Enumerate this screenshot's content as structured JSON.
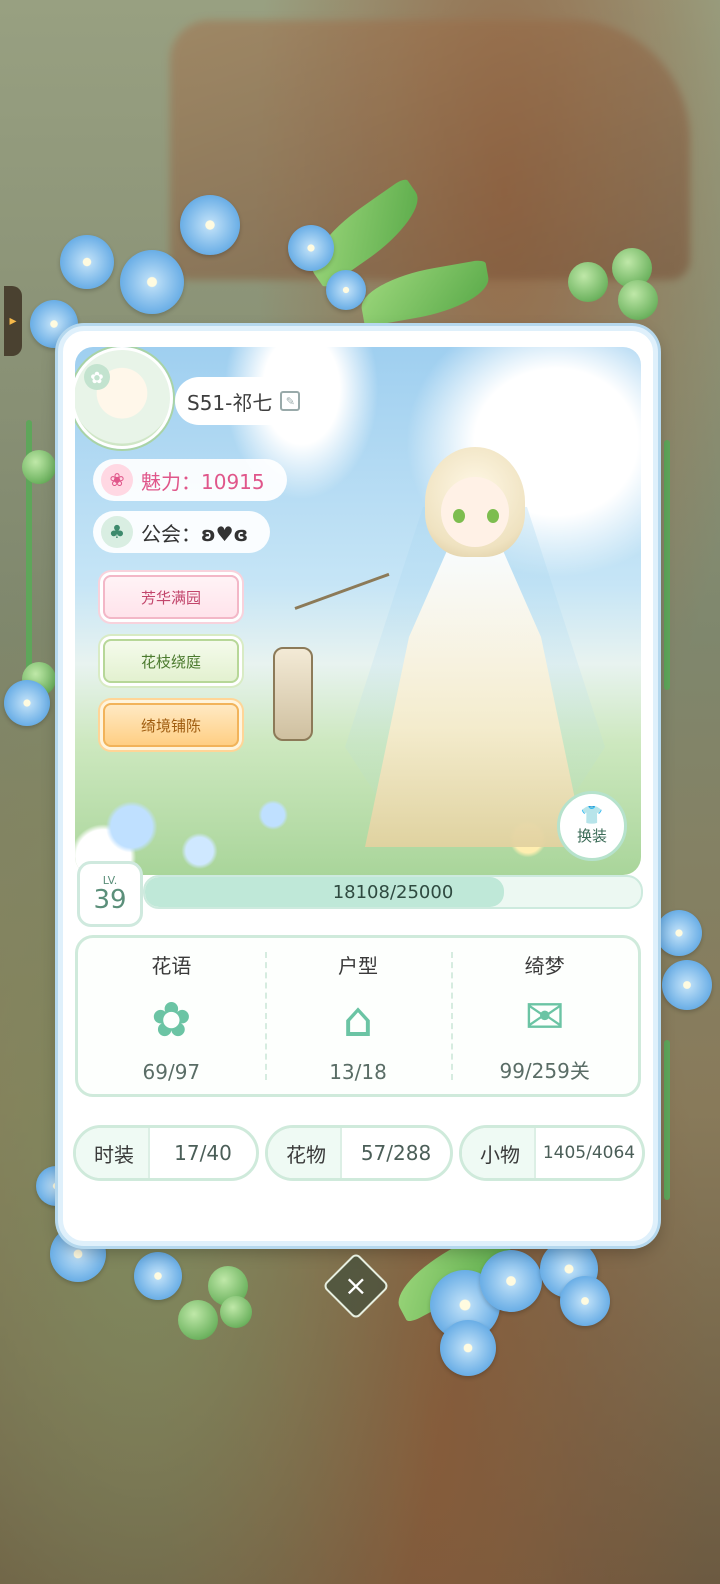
{
  "profile": {
    "name": "S51-祁七",
    "charm_label": "魅力：",
    "charm_value": "10915",
    "guild_label": "公会：",
    "guild_value": "ʚ♥ɞ"
  },
  "titles": [
    "芳华满园",
    "花枝绕庭",
    "绮境铺陈"
  ],
  "outfit_button": "换装",
  "level": {
    "lv_label": "LV.",
    "value": "39",
    "xp_text": "18108/25000",
    "xp_current": 18108,
    "xp_max": 25000
  },
  "collections": [
    {
      "title": "花语",
      "count": "69/97",
      "icon": "flower-icon"
    },
    {
      "title": "户型",
      "count": "13/18",
      "icon": "house-icon"
    },
    {
      "title": "绮梦",
      "count": "99/259关",
      "icon": "quill-letter-icon"
    }
  ],
  "items": [
    {
      "label": "时装",
      "value": "17/40"
    },
    {
      "label": "花物",
      "value": "57/288"
    },
    {
      "label": "小物",
      "value": "1405/4064"
    }
  ],
  "colors": {
    "accent": "#6bc4a4",
    "charm": "#e0568a"
  }
}
